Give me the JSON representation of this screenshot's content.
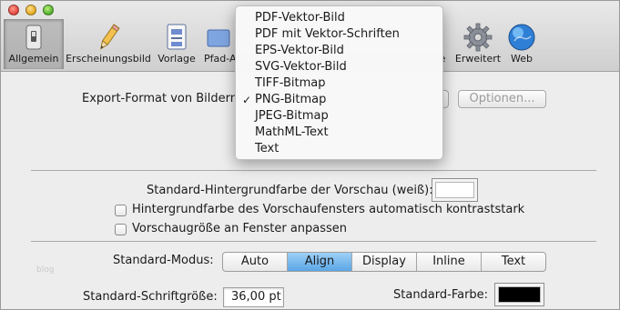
{
  "toolbar": {
    "items": [
      {
        "label": "Allgemein",
        "icon": "switch-icon"
      },
      {
        "label": "Erscheinungsbild",
        "icon": "pencil-icon"
      },
      {
        "label": "Vorlage",
        "icon": "template-icon"
      },
      {
        "label": "Pfad-A",
        "icon": "path-icon"
      },
      {
        "label": "e",
        "icon": "partial-icon"
      },
      {
        "label": "Erweitert",
        "icon": "gear-icon"
      },
      {
        "label": "Web",
        "icon": "globe-icon"
      }
    ]
  },
  "export": {
    "label": "Export-Format von Bildern",
    "options_button": "Optionen..."
  },
  "menu": {
    "items": [
      "PDF-Vektor-Bild",
      "PDF mit Vektor-Schriften",
      "EPS-Vektor-Bild",
      "SVG-Vektor-Bild",
      "TIFF-Bitmap",
      "PNG-Bitmap",
      "JPEG-Bitmap",
      "MathML-Text",
      "Text"
    ],
    "checked": "PNG-Bitmap",
    "check_mark": "✓"
  },
  "background": {
    "label": "Standard-Hintergrundfarbe der Vorschau (weiß):",
    "color": "#ffffff",
    "checkbox_contrast": "Hintergrundfarbe des Vorschaufensters automatisch kontraststark",
    "checkbox_fit": "Vorschaugröße an Fenster anpassen"
  },
  "mode": {
    "label": "Standard-Modus:",
    "options": [
      "Auto",
      "Align",
      "Display",
      "Inline",
      "Text"
    ],
    "selected": "Align"
  },
  "font_size": {
    "label": "Standard-Schriftgröße:",
    "value": "36,00 pt"
  },
  "color": {
    "label": "Standard-Farbe:",
    "value": "#000000"
  },
  "watermark": "blog",
  "colors": {
    "selection": "#5aa7e6"
  }
}
